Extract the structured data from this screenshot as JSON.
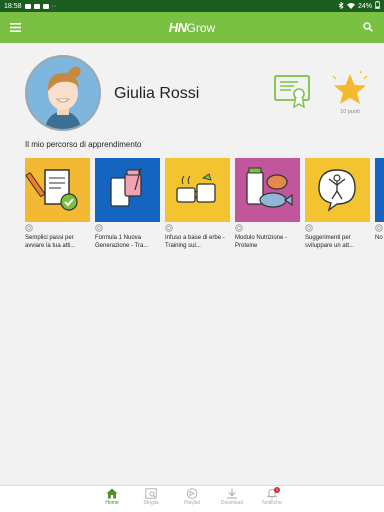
{
  "status_bar": {
    "time": "18:58",
    "dots": "··",
    "battery": "24%"
  },
  "app": {
    "brand_bold": "HN",
    "brand_light": "Grow"
  },
  "profile": {
    "name": "Giulia Rossi",
    "points": "10 punti"
  },
  "section": {
    "title": "Il mio percorso di apprendimento"
  },
  "courses": [
    {
      "title": "Semplici passi per avviare la tua atti...",
      "color": "#f4b933"
    },
    {
      "title": "Formula 1 Nuova Generazione - Tra...",
      "color": "#1565c0"
    },
    {
      "title": "Infuso a base di erbe - Training sul...",
      "color": "#f4c430"
    },
    {
      "title": "Modulo Nutrizione - Proteine",
      "color": "#c2569c"
    },
    {
      "title": "Suggerimenti per sviluppare un att...",
      "color": "#f4c430"
    },
    {
      "title": "No Ba...",
      "color": "#1565c0"
    }
  ],
  "nav": {
    "home": "Home",
    "explore": "Sfoglia",
    "playlist": "Playlist",
    "download": "Download",
    "notifications": "Notifiche",
    "badge": "1"
  },
  "colors": {
    "accent": "#7ac143",
    "statusbar": "#1b5e20",
    "star": "#f5b82e"
  }
}
